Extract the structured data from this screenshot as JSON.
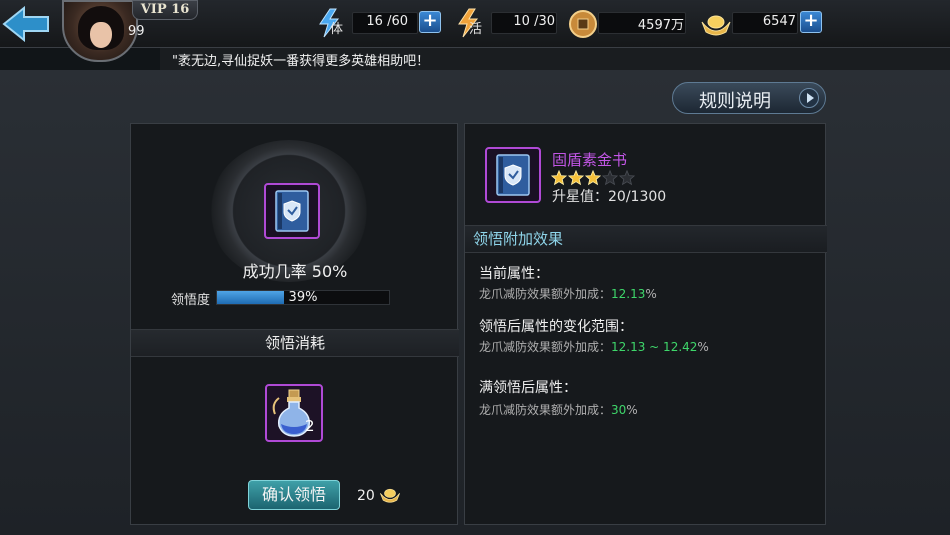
{
  "header": {
    "vip_label": "VIP 16",
    "level": "99",
    "marquee": "\"袤无边,寻仙捉妖一番获得更多英雄相助吧！",
    "stamina": {
      "label": "体",
      "value": "16 /60"
    },
    "vigor": {
      "label": "活",
      "value": "10 /30"
    },
    "copper": {
      "value": "4597万"
    },
    "gold": {
      "value": "6547"
    }
  },
  "rules_button": "规则说明",
  "left": {
    "success_rate": "成功几率 50%",
    "comprehension_label": "领悟度",
    "comprehension_progress": 0.39,
    "comprehension_text": "39%",
    "cost_header": "领悟消耗",
    "potion_count": "2",
    "confirm_button": "确认领悟",
    "gold_cost": "20"
  },
  "right": {
    "item_name": "固盾素金书",
    "stars_filled": 3,
    "stars_total": 5,
    "upgrade_label": "升星值：20/1300",
    "effect_header": "领悟附加效果",
    "current": {
      "title": "当前属性：",
      "line_prefix": "龙爪减防效果额外加成：",
      "value": "12.13",
      "suffix": "%"
    },
    "after": {
      "title": "领悟后属性的变化范围：",
      "line_prefix": "龙爪减防效果额外加成：",
      "value": "12.13 ~ 12.42",
      "suffix": "%"
    },
    "full": {
      "title": "满领悟后属性：",
      "line_prefix": "龙爪减防效果额外加成：",
      "value": "30",
      "suffix": "%"
    }
  },
  "colors": {
    "accent_green": "#3ed66a",
    "item_purple": "#c256e6",
    "effect_header": "#8fd5ea",
    "bar_blue": "#3a8ad0"
  }
}
